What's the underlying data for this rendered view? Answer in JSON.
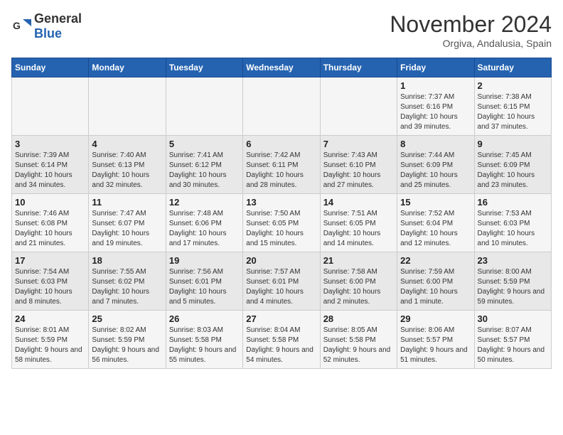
{
  "logo": {
    "text_general": "General",
    "text_blue": "Blue"
  },
  "header": {
    "month": "November 2024",
    "location": "Orgiva, Andalusia, Spain"
  },
  "weekdays": [
    "Sunday",
    "Monday",
    "Tuesday",
    "Wednesday",
    "Thursday",
    "Friday",
    "Saturday"
  ],
  "weeks": [
    [
      {
        "day": "",
        "info": ""
      },
      {
        "day": "",
        "info": ""
      },
      {
        "day": "",
        "info": ""
      },
      {
        "day": "",
        "info": ""
      },
      {
        "day": "",
        "info": ""
      },
      {
        "day": "1",
        "info": "Sunrise: 7:37 AM\nSunset: 6:16 PM\nDaylight: 10 hours and 39 minutes."
      },
      {
        "day": "2",
        "info": "Sunrise: 7:38 AM\nSunset: 6:15 PM\nDaylight: 10 hours and 37 minutes."
      }
    ],
    [
      {
        "day": "3",
        "info": "Sunrise: 7:39 AM\nSunset: 6:14 PM\nDaylight: 10 hours and 34 minutes."
      },
      {
        "day": "4",
        "info": "Sunrise: 7:40 AM\nSunset: 6:13 PM\nDaylight: 10 hours and 32 minutes."
      },
      {
        "day": "5",
        "info": "Sunrise: 7:41 AM\nSunset: 6:12 PM\nDaylight: 10 hours and 30 minutes."
      },
      {
        "day": "6",
        "info": "Sunrise: 7:42 AM\nSunset: 6:11 PM\nDaylight: 10 hours and 28 minutes."
      },
      {
        "day": "7",
        "info": "Sunrise: 7:43 AM\nSunset: 6:10 PM\nDaylight: 10 hours and 27 minutes."
      },
      {
        "day": "8",
        "info": "Sunrise: 7:44 AM\nSunset: 6:09 PM\nDaylight: 10 hours and 25 minutes."
      },
      {
        "day": "9",
        "info": "Sunrise: 7:45 AM\nSunset: 6:09 PM\nDaylight: 10 hours and 23 minutes."
      }
    ],
    [
      {
        "day": "10",
        "info": "Sunrise: 7:46 AM\nSunset: 6:08 PM\nDaylight: 10 hours and 21 minutes."
      },
      {
        "day": "11",
        "info": "Sunrise: 7:47 AM\nSunset: 6:07 PM\nDaylight: 10 hours and 19 minutes."
      },
      {
        "day": "12",
        "info": "Sunrise: 7:48 AM\nSunset: 6:06 PM\nDaylight: 10 hours and 17 minutes."
      },
      {
        "day": "13",
        "info": "Sunrise: 7:50 AM\nSunset: 6:05 PM\nDaylight: 10 hours and 15 minutes."
      },
      {
        "day": "14",
        "info": "Sunrise: 7:51 AM\nSunset: 6:05 PM\nDaylight: 10 hours and 14 minutes."
      },
      {
        "day": "15",
        "info": "Sunrise: 7:52 AM\nSunset: 6:04 PM\nDaylight: 10 hours and 12 minutes."
      },
      {
        "day": "16",
        "info": "Sunrise: 7:53 AM\nSunset: 6:03 PM\nDaylight: 10 hours and 10 minutes."
      }
    ],
    [
      {
        "day": "17",
        "info": "Sunrise: 7:54 AM\nSunset: 6:03 PM\nDaylight: 10 hours and 8 minutes."
      },
      {
        "day": "18",
        "info": "Sunrise: 7:55 AM\nSunset: 6:02 PM\nDaylight: 10 hours and 7 minutes."
      },
      {
        "day": "19",
        "info": "Sunrise: 7:56 AM\nSunset: 6:01 PM\nDaylight: 10 hours and 5 minutes."
      },
      {
        "day": "20",
        "info": "Sunrise: 7:57 AM\nSunset: 6:01 PM\nDaylight: 10 hours and 4 minutes."
      },
      {
        "day": "21",
        "info": "Sunrise: 7:58 AM\nSunset: 6:00 PM\nDaylight: 10 hours and 2 minutes."
      },
      {
        "day": "22",
        "info": "Sunrise: 7:59 AM\nSunset: 6:00 PM\nDaylight: 10 hours and 1 minute."
      },
      {
        "day": "23",
        "info": "Sunrise: 8:00 AM\nSunset: 5:59 PM\nDaylight: 9 hours and 59 minutes."
      }
    ],
    [
      {
        "day": "24",
        "info": "Sunrise: 8:01 AM\nSunset: 5:59 PM\nDaylight: 9 hours and 58 minutes."
      },
      {
        "day": "25",
        "info": "Sunrise: 8:02 AM\nSunset: 5:59 PM\nDaylight: 9 hours and 56 minutes."
      },
      {
        "day": "26",
        "info": "Sunrise: 8:03 AM\nSunset: 5:58 PM\nDaylight: 9 hours and 55 minutes."
      },
      {
        "day": "27",
        "info": "Sunrise: 8:04 AM\nSunset: 5:58 PM\nDaylight: 9 hours and 54 minutes."
      },
      {
        "day": "28",
        "info": "Sunrise: 8:05 AM\nSunset: 5:58 PM\nDaylight: 9 hours and 52 minutes."
      },
      {
        "day": "29",
        "info": "Sunrise: 8:06 AM\nSunset: 5:57 PM\nDaylight: 9 hours and 51 minutes."
      },
      {
        "day": "30",
        "info": "Sunrise: 8:07 AM\nSunset: 5:57 PM\nDaylight: 9 hours and 50 minutes."
      }
    ]
  ]
}
